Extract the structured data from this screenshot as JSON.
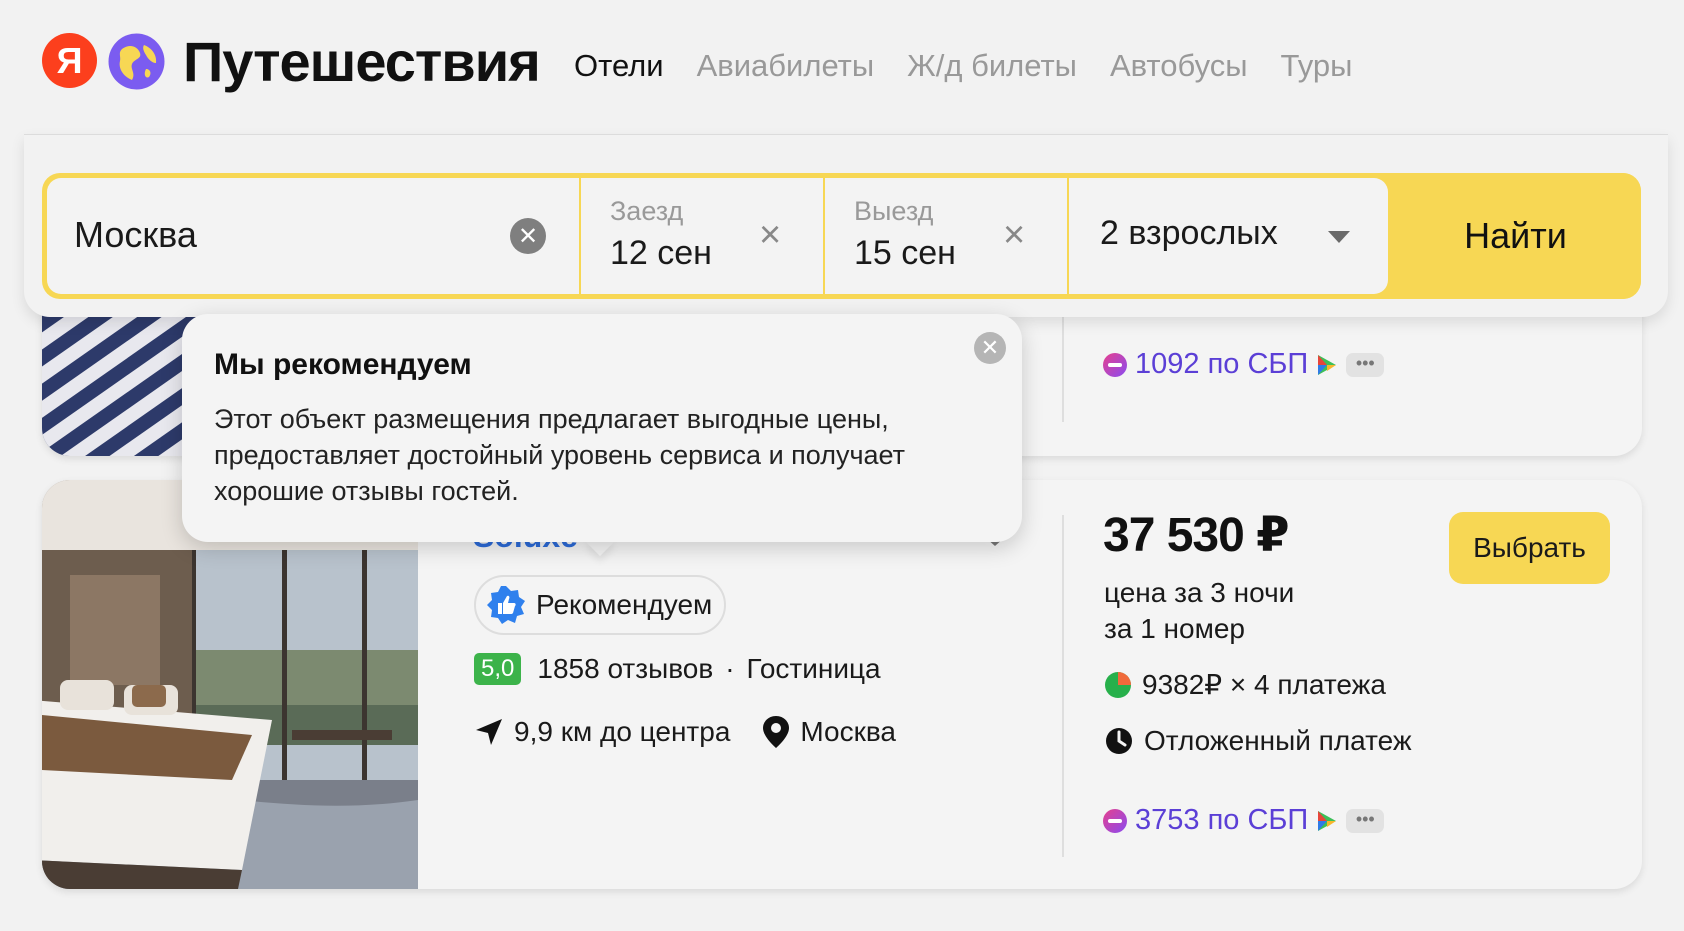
{
  "header": {
    "logo_letter": "Я",
    "brand": "Путешествия",
    "nav": [
      {
        "label": "Отели",
        "active": true
      },
      {
        "label": "Авиабилеты",
        "active": false
      },
      {
        "label": "Ж/д билеты",
        "active": false
      },
      {
        "label": "Автобусы",
        "active": false
      },
      {
        "label": "Туры",
        "active": false
      }
    ]
  },
  "search": {
    "destination": "Москва",
    "checkin_label": "Заезд",
    "checkin_value": "12 сен",
    "checkout_label": "Выезд",
    "checkout_value": "15 сен",
    "guests": "2 взрослых",
    "submit": "Найти"
  },
  "card_top": {
    "sbp": "1092 по СБП",
    "more": "•••"
  },
  "popover": {
    "title": "Мы рекомендуем",
    "body": "Этот объект размещения предлагает выгодные цены, предоставляет достойный уровень сервиса и получает хорошие отзывы гостей."
  },
  "hotel": {
    "name_partial": "Soluxe",
    "recommend": "Рекомендуем",
    "rating": "5,0",
    "reviews": "1858 отзывов",
    "separator": "·",
    "type": "Гостиница",
    "distance": "9,9 км до центра",
    "city": "Москва",
    "price": "37 530 ₽",
    "price_note_1": "цена за 3 ночи",
    "price_note_2": "за 1 номер",
    "installments": "9382₽ × 4 платежа",
    "deferred": "Отложенный платеж",
    "sbp": "3753 по СБП",
    "more": "•••",
    "select": "Выбрать"
  },
  "colors": {
    "accent_yellow": "#f7d754",
    "yandex_red": "#fc3f1d",
    "sbp_purple": "#5b3fd6",
    "rating_green": "#3cb34a",
    "link_blue": "#2c6bd9"
  },
  "icons": [
    "yandex-logo",
    "globe-icon",
    "clear-icon",
    "close-icon",
    "chevron-down-icon",
    "thumbs-up-badge-icon",
    "navigation-arrow-icon",
    "map-pin-icon",
    "split-pay-icon",
    "deferred-clock-icon",
    "sbp-icon"
  ]
}
